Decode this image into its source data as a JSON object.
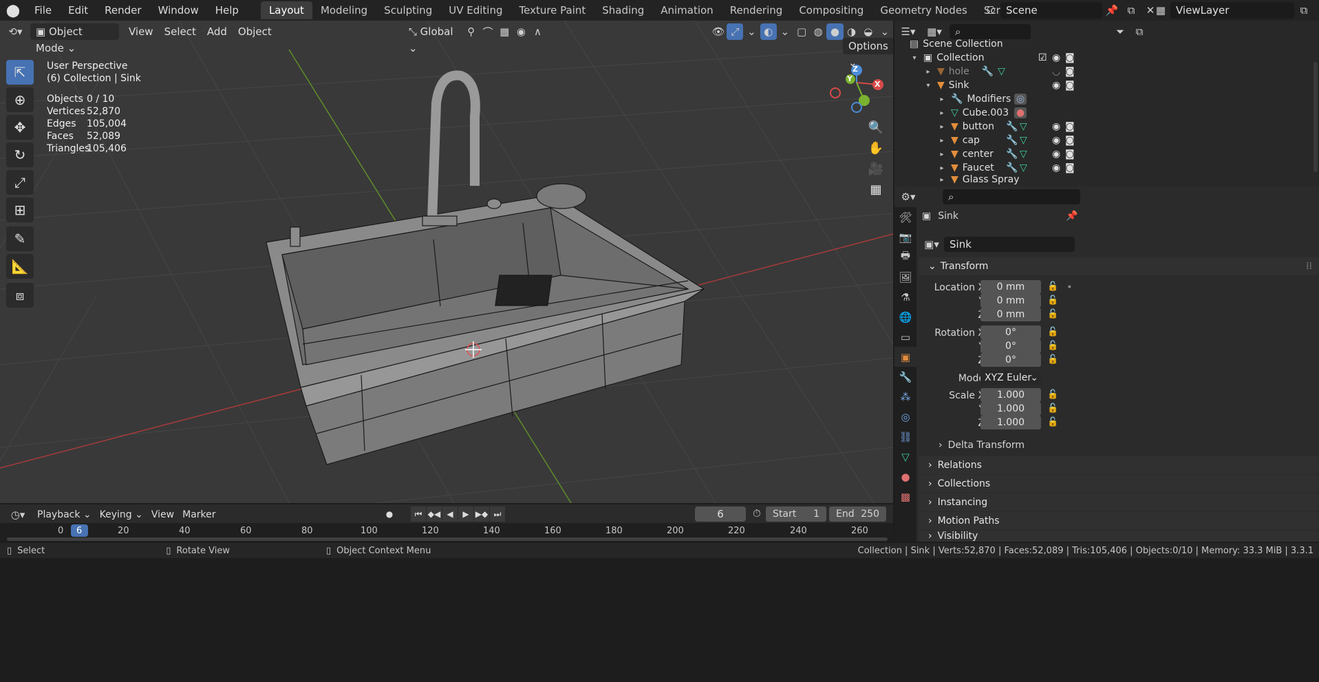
{
  "menu": [
    "File",
    "Edit",
    "Render",
    "Window",
    "Help"
  ],
  "workspaces": [
    {
      "label": "Layout",
      "active": true
    },
    {
      "label": "Modeling"
    },
    {
      "label": "Sculpting"
    },
    {
      "label": "UV Editing"
    },
    {
      "label": "Texture Paint"
    },
    {
      "label": "Shading"
    },
    {
      "label": "Animation"
    },
    {
      "label": "Rendering"
    },
    {
      "label": "Compositing"
    },
    {
      "label": "Geometry Nodes"
    },
    {
      "label": "Scripting"
    }
  ],
  "scene": "Scene",
  "view_layer": "ViewLayer",
  "viewport": {
    "mode": "Object Mode",
    "menus": [
      "View",
      "Select",
      "Add",
      "Object"
    ],
    "orientation": "Global",
    "options": "Options",
    "overlay_title": "User Perspective",
    "overlay_collection": "(6) Collection | Sink",
    "stats": [
      {
        "label": "Objects",
        "value": "0 / 10"
      },
      {
        "label": "Vertices",
        "value": "52,870"
      },
      {
        "label": "Edges",
        "value": "105,004"
      },
      {
        "label": "Faces",
        "value": "52,089"
      },
      {
        "label": "Triangles",
        "value": "105,406"
      }
    ],
    "gizmo": {
      "x": "X",
      "y": "Y",
      "z": "Z"
    }
  },
  "outliner": {
    "root": "Scene Collection",
    "rows": [
      {
        "label": "Collection",
        "depth": 0,
        "type": "collection"
      },
      {
        "label": "hole",
        "depth": 1,
        "type": "object",
        "dim": true
      },
      {
        "label": "Sink",
        "depth": 1,
        "type": "object"
      },
      {
        "label": "Modifiers",
        "depth": 2,
        "type": "modifier"
      },
      {
        "label": "Cube.003",
        "depth": 2,
        "type": "mesh"
      },
      {
        "label": "button",
        "depth": 2,
        "type": "object"
      },
      {
        "label": "cap",
        "depth": 2,
        "type": "object"
      },
      {
        "label": "center",
        "depth": 2,
        "type": "object"
      },
      {
        "label": "Faucet",
        "depth": 2,
        "type": "object"
      },
      {
        "label": "Glass Spray",
        "depth": 2,
        "type": "object"
      }
    ]
  },
  "properties": {
    "object_name": "Sink",
    "data_name": "Sink",
    "transform": {
      "title": "Transform",
      "location_label": "Location X",
      "rotation_label": "Rotation X",
      "scale_label": "Scale X",
      "y": "Y",
      "z": "Z",
      "location": [
        "0 mm",
        "0 mm",
        "0 mm"
      ],
      "rotation": [
        "0°",
        "0°",
        "0°"
      ],
      "mode_label": "Mode",
      "mode": "XYZ Euler",
      "scale": [
        "1.000",
        "1.000",
        "1.000"
      ],
      "delta": "Delta Transform"
    },
    "panels": [
      "Relations",
      "Collections",
      "Instancing",
      "Motion Paths",
      "Visibility"
    ]
  },
  "timeline": {
    "menus": [
      "Playback",
      "Keying",
      "View",
      "Marker"
    ],
    "current_frame": "6",
    "start_label": "Start",
    "start": "1",
    "end_label": "End",
    "end": "250",
    "ticks": [
      "0",
      "6",
      "20",
      "40",
      "60",
      "80",
      "100",
      "120",
      "140",
      "160",
      "180",
      "200",
      "220",
      "240",
      "260"
    ]
  },
  "status": {
    "select": "Select",
    "rotate": "Rotate View",
    "context": "Object Context Menu",
    "info": "Collection | Sink | Verts:52,870 | Faces:52,089 | Tris:105,406 | Objects:0/10 | Memory: 33.3 MiB | 3.3.1"
  },
  "colors": {
    "accent": "#4772b3",
    "object": "#e38d3c",
    "x_axis": "#d84a4a",
    "y_axis": "#7ab32f",
    "z_axis": "#4c8cd8"
  }
}
